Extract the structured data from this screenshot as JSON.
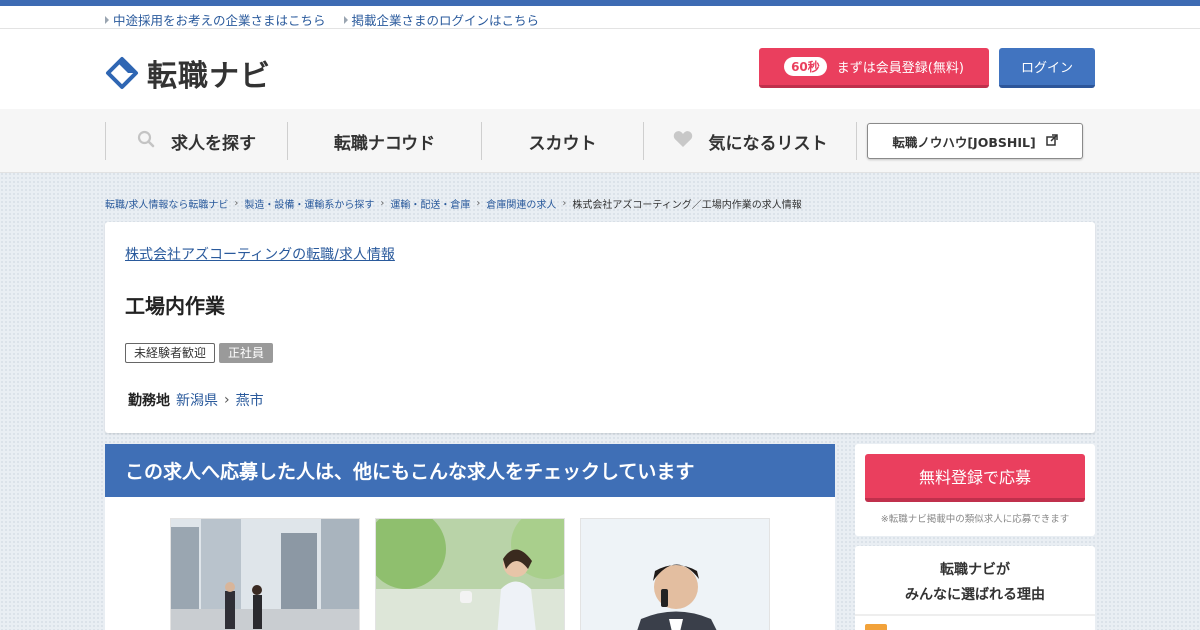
{
  "utility": {
    "links": [
      {
        "label": "中途採用をお考えの企業さまはこちら"
      },
      {
        "label": "掲載企業さまのログインはこちら"
      }
    ]
  },
  "header": {
    "logo_text": "転職ナビ",
    "register_badge": "60秒",
    "register_label": "まずは会員登録(無料)",
    "login_label": "ログイン"
  },
  "gnav": {
    "items": [
      {
        "label": "求人を探す",
        "icon": "search-icon"
      },
      {
        "label": "転職ナコウド"
      },
      {
        "label": "スカウト"
      },
      {
        "label": "気になるリスト",
        "icon": "heart-icon"
      }
    ],
    "external_label": "転職ノウハウ[JOBSHIL]"
  },
  "breadcrumb": {
    "items": [
      "転職/求人情報なら転職ナビ",
      "製造・設備・運輸系から探す",
      "運輸・配送・倉庫",
      "倉庫関連の求人"
    ],
    "current": "株式会社アズコーティング／工場内作業の求人情報"
  },
  "job": {
    "company": "株式会社アズコーティングの転職/求人情報",
    "title": "工場内作業",
    "tags": [
      "未経験者歓迎",
      "正社員"
    ],
    "location_label": "勤務地",
    "prefecture": "新潟県",
    "city": "燕市"
  },
  "recommend": {
    "heading": "この求人へ応募した人は、他にもこんな求人をチェックしています"
  },
  "sidebar": {
    "apply_label": "無料登録で応募",
    "apply_note": "※転職ナビ掲載中の類似求人に応募できます",
    "reason_line1": "転職ナビが",
    "reason_line2": "みんなに選ばれる理由"
  },
  "colors": {
    "accent_blue": "#3f6fb6",
    "cta_red": "#ea3f5e",
    "link_blue": "#2a5a9c"
  }
}
